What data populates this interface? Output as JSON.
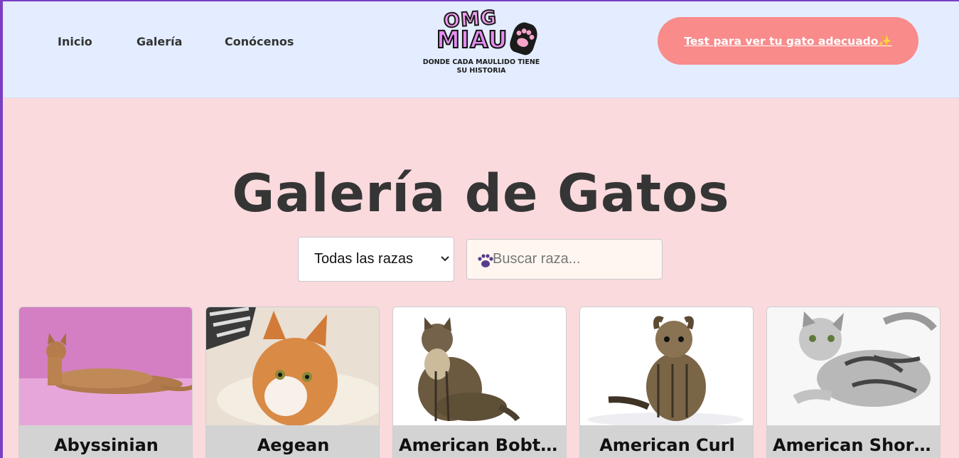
{
  "nav": {
    "inicio": "Inicio",
    "galeria": "Galería",
    "conocenos": "Conócenos"
  },
  "logo": {
    "top_word": "OMG",
    "main_word": "MIAU",
    "tagline": "DONDE CADA MAULLIDO TIENE SU HISTORIA"
  },
  "cta": {
    "label": "Test para ver tu gato adecuado✨"
  },
  "page": {
    "title": "Galería de Gatos"
  },
  "filters": {
    "breed_select": {
      "selected": "Todas las razas"
    },
    "search": {
      "placeholder": "Buscar raza..."
    }
  },
  "cards": [
    {
      "name": "Abyssinian"
    },
    {
      "name": "Aegean"
    },
    {
      "name": "American Bobtail"
    },
    {
      "name": "American Curl"
    },
    {
      "name": "American Shorthair"
    }
  ],
  "colors": {
    "header_bg": "#e3edff",
    "page_bg": "#fadadd",
    "cta_bg": "#f98b8b",
    "caption_bg": "#d3d3d3",
    "window_border": "#7b3fc4"
  }
}
